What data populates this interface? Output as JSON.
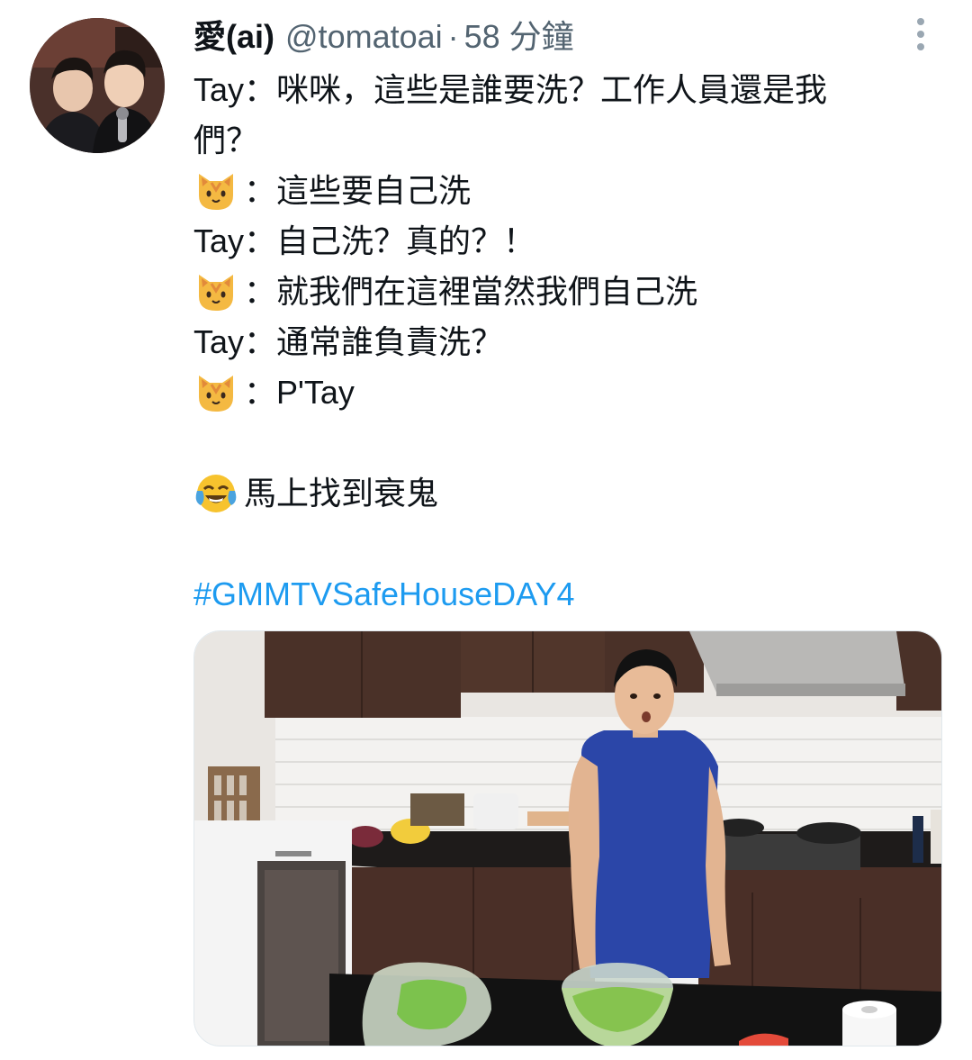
{
  "tweet": {
    "author": {
      "display_name": "愛(ai)",
      "handle": "@tomatoai",
      "separator": "·",
      "time": "58 分鐘",
      "avatar": "avatar-photo"
    },
    "more_icon": "more-vertical-icon",
    "lines": {
      "l1": "Tay：咪咪，這些是誰要洗？工作人員還是我",
      "l2": "們？",
      "l3": "：這些要自己洗",
      "l4": "Tay：自己洗？真的？！",
      "l5": "：就我們在這裡當然我們自己洗",
      "l6": "Tay：通常誰負責洗？",
      "l7": "：P'Tay",
      "l8": "馬上找到衰鬼",
      "hashtag": "#GMMTVSafeHouseDAY4"
    },
    "emojis": {
      "cat": "cat-face-icon",
      "laugh": "face-with-tears-of-joy-icon"
    },
    "media": "kitchen-video-thumbnail"
  },
  "colors": {
    "text": "#0f1419",
    "secondary": "#536471",
    "link": "#1d9bf0",
    "background": "#ffffff"
  }
}
